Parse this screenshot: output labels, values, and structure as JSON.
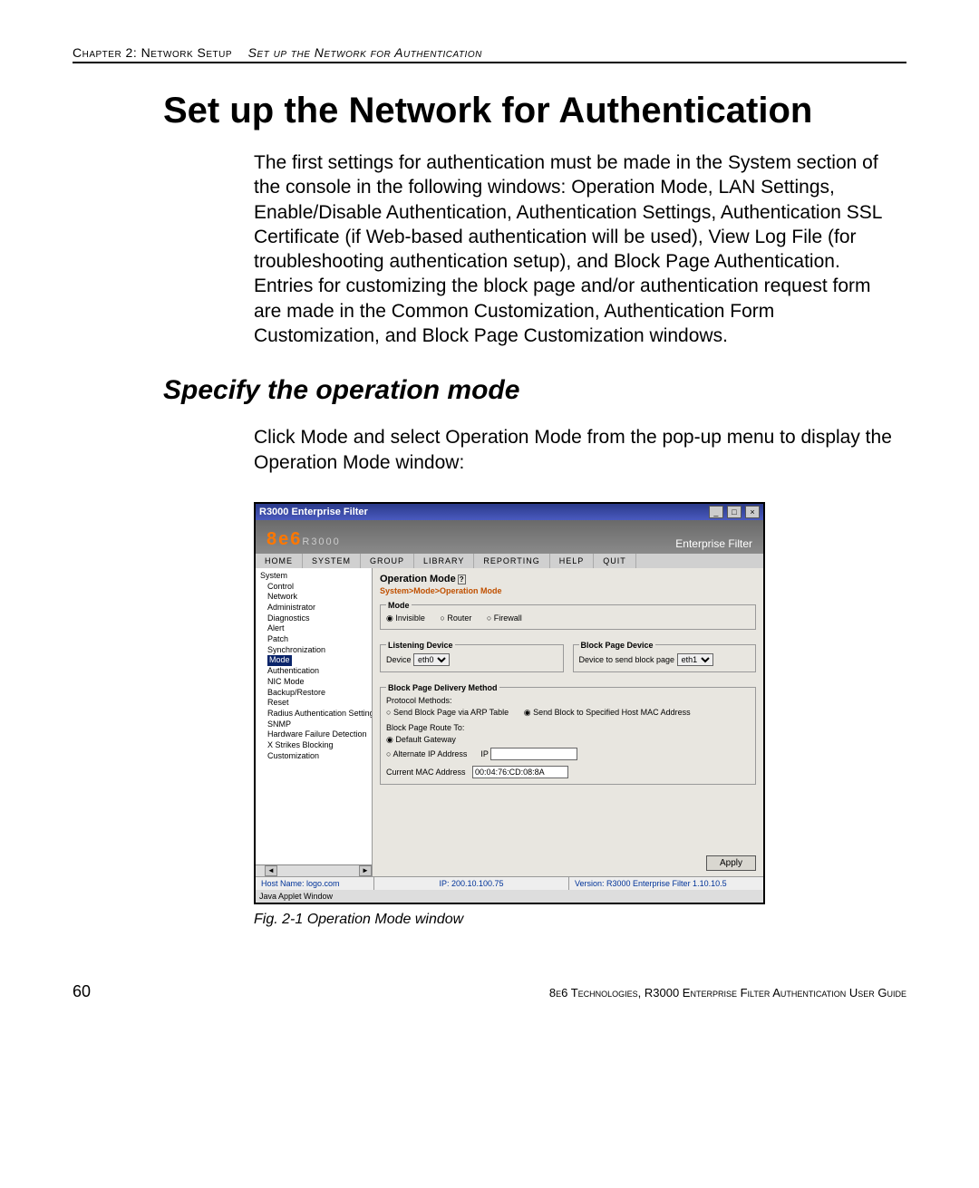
{
  "header": {
    "chapter": "Chapter 2: Network Setup",
    "section": "Set up the Network for Authentication"
  },
  "title": "Set up the Network for Authentication",
  "intro": "The first settings for authentication must be made in the System section of the console in the following windows: Operation Mode, LAN Settings, Enable/Disable Authentication, Authentication Settings, Authentication SSL Certificate (if Web-based authentication will be used), View Log File (for troubleshooting authentication setup), and Block Page Authentication. Entries for customizing the block page and/or authentication request form are made in the Common Customization, Authentication Form Customization, and Block Page Customization windows.",
  "subtitle": "Specify the operation mode",
  "subpara": "Click Mode and select Operation Mode from the pop-up menu to display the Operation Mode window:",
  "app": {
    "window_title": "R3000 Enterprise Filter",
    "brand": "8e6",
    "brand_suffix": "R3000",
    "brand_right": "Enterprise Filter",
    "menu": [
      "HOME",
      "SYSTEM",
      "GROUP",
      "LIBRARY",
      "REPORTING",
      "HELP",
      "QUIT"
    ],
    "tree": {
      "root": "System",
      "items": [
        "Control",
        "Network",
        "Administrator",
        "Diagnostics",
        "Alert",
        "Patch",
        "Synchronization",
        "Mode",
        "Authentication",
        "NIC Mode",
        "Backup/Restore",
        "Reset",
        "Radius Authentication Setting",
        "SNMP",
        "Hardware Failure Detection",
        "X Strikes Blocking",
        "Customization"
      ],
      "selected": "Mode"
    },
    "panel": {
      "title": "Operation Mode",
      "breadcrumb": "System>Mode>Operation Mode",
      "mode_legend": "Mode",
      "mode_options": [
        "Invisible",
        "Router",
        "Firewall"
      ],
      "mode_selected": "Invisible",
      "listening_legend": "Listening Device",
      "listening_label": "Device",
      "listening_value": "eth0",
      "block_device_legend": "Block Page Device",
      "block_device_label": "Device to send block page",
      "block_device_value": "eth1",
      "delivery_legend": "Block Page Delivery Method",
      "protocol_label": "Protocol Methods:",
      "protocol_options": [
        "Send Block Page via ARP Table",
        "Send Block to Specified Host MAC Address"
      ],
      "protocol_selected": "Send Block to Specified Host MAC Address",
      "route_label": "Block Page Route To:",
      "route_options": [
        "Default Gateway",
        "Alternate IP Address"
      ],
      "route_selected": "Default Gateway",
      "ip_label": "IP",
      "ip_value": "",
      "mac_label": "Current MAC Address",
      "mac_value": "00:04:76:CD:08:8A",
      "apply": "Apply"
    },
    "status": {
      "host": "Host Name: logo.com",
      "ip": "IP: 200.10.100.75",
      "version": "Version: R3000 Enterprise Filter 1.10.10.5"
    },
    "java_row": "Java Applet Window"
  },
  "figure_caption": "Fig. 2-1  Operation Mode window",
  "footer": {
    "page": "60",
    "text": "8e6 Technologies, R3000 Enterprise Filter Authentication User Guide"
  }
}
